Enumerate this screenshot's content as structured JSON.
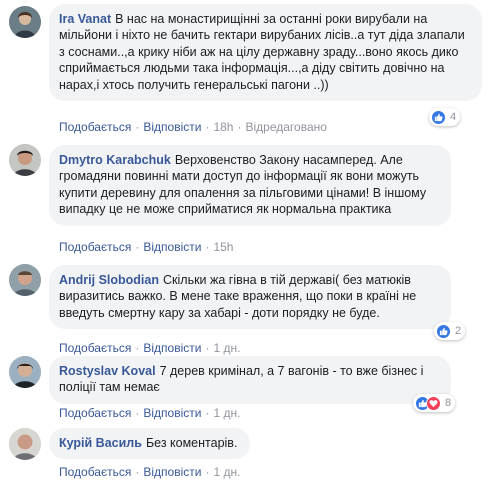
{
  "comments": [
    {
      "author": "Ira Vanat",
      "text": "В нас на монастирищінні за останні роки вирубали на мільйони і ніхто не бачить гектари вирубаних лісів..а тут діда злапали з соснами..,а крику ніби аж на цілу державну зраду...воно якось дико сприймається людьми така інформація...,а діду світить довічно на нарах,і хтось получить генеральські пагони ..))",
      "like_label": "Подобається",
      "reply_label": "Відповісти",
      "time": "18h",
      "edited": "Відредаговано",
      "reaction_count": "4",
      "reactions": [
        "like"
      ]
    },
    {
      "author": "Dmytro Karabchuk",
      "text": "Верховенство Закону насамперед. Але громадяни повинні мати доступ до інформації як вони можуть купити деревину для опалення за пільговими цінами! В іншому випадку це не може сприйматися як нормальна практика",
      "like_label": "Подобається",
      "reply_label": "Відповісти",
      "time": "15h"
    },
    {
      "author": "Andrij Slobodian",
      "text": "Скільки жа гівна в тій державі( без матюків виразитись важко. В мене таке враження, що поки в країні не введуть смертну кару за хабарі - доти порядку не буде.",
      "like_label": "Подобається",
      "reply_label": "Відповісти",
      "time": "1 дн.",
      "reaction_count": "2",
      "reactions": [
        "like"
      ]
    },
    {
      "author": "Rostyslav Koval",
      "text": "7 дерев кримінал, а 7 вагонів - то вже бізнес і поліції там немає",
      "like_label": "Подобається",
      "reply_label": "Відповісти",
      "time": "1 дн.",
      "reaction_count": "8",
      "reactions": [
        "like",
        "love"
      ]
    },
    {
      "author": "Курій Василь",
      "text": "Без коментарів.",
      "like_label": "Подобається",
      "reply_label": "Відповісти",
      "time": "1 дн."
    }
  ],
  "colors": {
    "link": "#385898",
    "bubble": "#f2f3f5",
    "like": "#3578e5",
    "love": "#f33e58",
    "muted": "#90949c"
  },
  "icons": {
    "like_reaction": "thumbs-up-icon",
    "love_reaction": "heart-icon"
  }
}
